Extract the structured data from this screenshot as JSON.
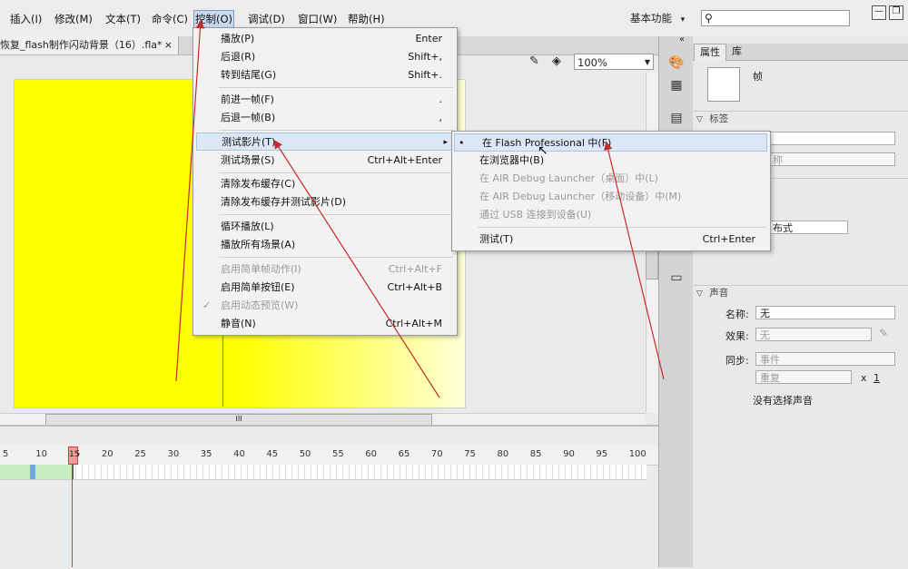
{
  "menubar": {
    "items": [
      "插入(I)",
      "修改(M)",
      "文本(T)",
      "命令(C)",
      "控制(O)",
      "调试(D)",
      "窗口(W)",
      "帮助(H)"
    ],
    "active_item": "控制(O)",
    "workspace_label": "基本功能",
    "workspace_caret": "▾",
    "search_icon": "⚲"
  },
  "window_controls": {
    "minimize": "—",
    "restore": "❐"
  },
  "document": {
    "tab_title": "恢复_flash制作闪动背景（16）.fla*",
    "tab_close": "×",
    "zoom": "100%",
    "scroll_grip": "III"
  },
  "control_menu": {
    "items": [
      {
        "label": "播放(P)",
        "shortcut": "Enter"
      },
      {
        "label": "后退(R)",
        "shortcut": "Shift+,"
      },
      {
        "label": "转到结尾(G)",
        "shortcut": "Shift+."
      },
      {
        "label": "前进一帧(F)",
        "shortcut": "."
      },
      {
        "label": "后退一帧(B)",
        "shortcut": ","
      },
      {
        "label": "测试影片(T)",
        "shortcut": "▸"
      },
      {
        "label": "测试场景(S)",
        "shortcut": "Ctrl+Alt+Enter"
      },
      {
        "label": "清除发布缓存(C)",
        "shortcut": ""
      },
      {
        "label": "清除发布缓存并测试影片(D)",
        "shortcut": ""
      },
      {
        "label": "循环播放(L)",
        "shortcut": ""
      },
      {
        "label": "播放所有场景(A)",
        "shortcut": ""
      },
      {
        "label": "启用简单帧动作(I)",
        "shortcut": "Ctrl+Alt+F"
      },
      {
        "label": "启用简单按钮(E)",
        "shortcut": "Ctrl+Alt+B"
      },
      {
        "label": "启用动态预览(W)",
        "shortcut": ""
      },
      {
        "label": "静音(N)",
        "shortcut": "Ctrl+Alt+M"
      }
    ],
    "check_mark": "✓"
  },
  "test_movie_submenu": {
    "items": [
      {
        "label": "在 Flash Professional 中(F)",
        "shortcut": ""
      },
      {
        "label": "在浏览器中(B)",
        "shortcut": ""
      },
      {
        "label": "在 AIR Debug Launcher（桌面）中(L)",
        "shortcut": ""
      },
      {
        "label": "在 AIR Debug Launcher（移动设备）中(M)",
        "shortcut": ""
      },
      {
        "label": "通过 USB 连接到设备(U)",
        "shortcut": ""
      },
      {
        "label": "测试(T)",
        "shortcut": "Ctrl+Enter"
      }
    ],
    "bullet": "•"
  },
  "timeline": {
    "ticks": [
      "5",
      "10",
      "15",
      "20",
      "25",
      "30",
      "35",
      "40",
      "45",
      "50",
      "55",
      "60",
      "65",
      "70",
      "75",
      "80",
      "85",
      "90",
      "95",
      "100"
    ],
    "current_frame": "15"
  },
  "properties": {
    "tabs": [
      "属性",
      "库"
    ],
    "frame_label": "帧",
    "section_label": "标签",
    "label_type_partial": "称",
    "style_partial": "布式",
    "section_sound": "声音",
    "name_label": "名称:",
    "name_value": "无",
    "effect_label": "效果:",
    "effect_value": "无",
    "sync_label": "同步:",
    "sync_value": "事件",
    "repeat_value": "重复",
    "repeat_x": "x",
    "repeat_count": "1",
    "no_sound": "没有选择声音",
    "collapse_caret": "▽",
    "pencil_icon": "✎"
  },
  "tools": {
    "icons": [
      "🎨",
      "▦",
      "▤",
      "▭"
    ],
    "collapse": "«"
  },
  "colors": {
    "stage_fill": "#ffff00",
    "arrow_red": "#c62b2b",
    "menu_highlight": "#dce7f6"
  }
}
